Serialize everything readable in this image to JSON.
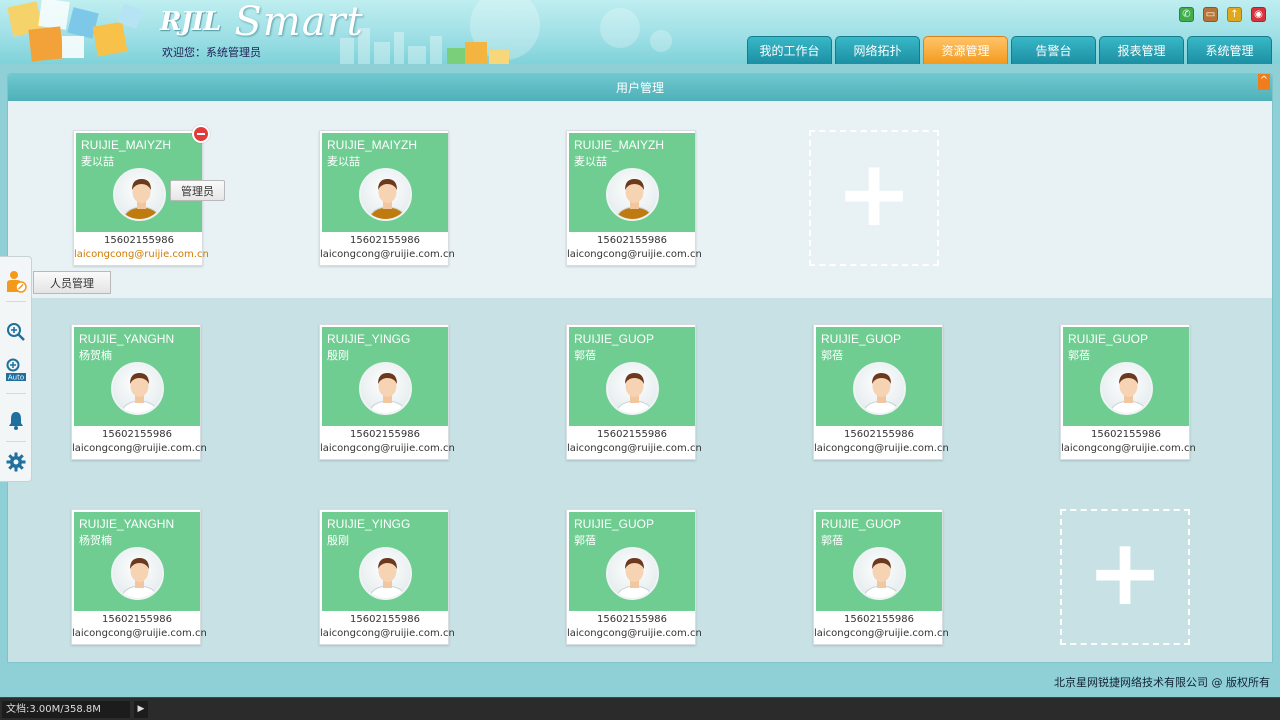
{
  "header": {
    "logo_brand": "RJIL",
    "logo_product": "Smart",
    "welcome": "欢迎您：系统管理员",
    "nav_tabs": [
      {
        "label": "我的工作台",
        "active": false
      },
      {
        "label": "网络拓扑",
        "active": false
      },
      {
        "label": "资源管理",
        "active": true
      },
      {
        "label": "告警台",
        "active": false
      },
      {
        "label": "报表管理",
        "active": false
      },
      {
        "label": "系统管理",
        "active": false
      }
    ],
    "top_icons": [
      "phone-icon",
      "wallet-icon",
      "upload-icon",
      "power-icon"
    ]
  },
  "panel": {
    "title": "用户管理"
  },
  "cards": [
    {
      "uid": "RUIJIE_MAIYZH",
      "name": "麦以喆",
      "phone": "15602155986",
      "email": "laicongcong@ruijie.com.cn",
      "shirt": "#c07b10",
      "email_highlight": true
    },
    {
      "uid": "RUIJIE_MAIYZH",
      "name": "麦以喆",
      "phone": "15602155986",
      "email": "laicongcong@ruijie.com.cn",
      "shirt": "#c07b10",
      "email_highlight": false
    },
    {
      "uid": "RUIJIE_MAIYZH",
      "name": "麦以喆",
      "phone": "15602155986",
      "email": "laicongcong@ruijie.com.cn",
      "shirt": "#c07b10",
      "email_highlight": false
    },
    {
      "uid": "RUIJIE_YANGHN",
      "name": "杨贺楠",
      "phone": "15602155986",
      "email": "laicongcong@ruijie.com.cn",
      "shirt": "#ffffff",
      "email_highlight": false
    },
    {
      "uid": "RUIJIE_YINGG",
      "name": "殷刚",
      "phone": "15602155986",
      "email": "laicongcong@ruijie.com.cn",
      "shirt": "#ffffff",
      "email_highlight": false
    },
    {
      "uid": "RUIJIE_GUOP",
      "name": "郭蓓",
      "phone": "15602155986",
      "email": "laicongcong@ruijie.com.cn",
      "shirt": "#ffffff",
      "email_highlight": false
    },
    {
      "uid": "RUIJIE_GUOP",
      "name": "郭蓓",
      "phone": "15602155986",
      "email": "laicongcong@ruijie.com.cn",
      "shirt": "#ffffff",
      "email_highlight": false
    },
    {
      "uid": "RUIJIE_GUOP",
      "name": "郭蓓",
      "phone": "15602155986",
      "email": "laicongcong@ruijie.com.cn",
      "shirt": "#ffffff",
      "email_highlight": false
    },
    {
      "uid": "RUIJIE_YANGHN",
      "name": "杨贺楠",
      "phone": "15602155986",
      "email": "laicongcong@ruijie.com.cn",
      "shirt": "#ffffff",
      "email_highlight": false
    },
    {
      "uid": "RUIJIE_YINGG",
      "name": "殷刚",
      "phone": "15602155986",
      "email": "laicongcong@ruijie.com.cn",
      "shirt": "#ffffff",
      "email_highlight": false
    },
    {
      "uid": "RUIJIE_GUOP",
      "name": "郭蓓",
      "phone": "15602155986",
      "email": "laicongcong@ruijie.com.cn",
      "shirt": "#ffffff",
      "email_highlight": false
    },
    {
      "uid": "RUIJIE_GUOP",
      "name": "郭蓓",
      "phone": "15602155986",
      "email": "laicongcong@ruijie.com.cn",
      "shirt": "#ffffff",
      "email_highlight": false
    }
  ],
  "role_tooltip": "管理员",
  "left_toolbar": {
    "tooltip": "人员管理",
    "items": [
      "person-manage-icon",
      "zoom-in-icon",
      "zoom-auto-icon",
      "bell-icon",
      "gear-icon"
    ]
  },
  "footer": {
    "copyright": "北京星网锐捷网络技术有限公司 @ 版权所有"
  },
  "statusbar": {
    "doc": "文档:3.00M/358.8M"
  },
  "colors": {
    "accent_active": "#f39a1c",
    "tab": "#1c8fa3",
    "card_green": "#6fcd92",
    "remove_badge": "#e23b3b"
  }
}
